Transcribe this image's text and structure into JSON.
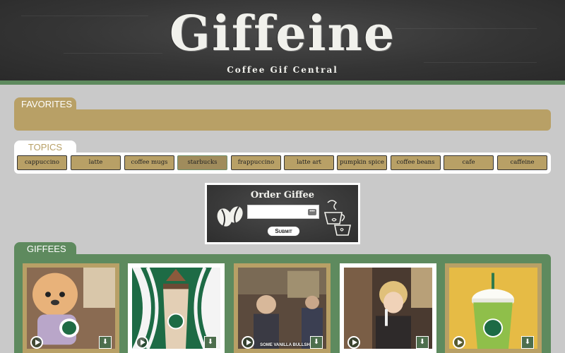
{
  "header": {
    "title": "Giffeine",
    "tagline": "Coffee Gif Central"
  },
  "favorites": {
    "tab_label": "FAVORITES"
  },
  "topics": {
    "tab_label": "TOPICS",
    "items": [
      "cappuccino",
      "latte",
      "coffee mugs",
      "starbucks",
      "frappuccino",
      "latte art",
      "pumpkin spice",
      "coffee beans",
      "cafe",
      "caffeine"
    ],
    "active": "starbucks"
  },
  "order": {
    "title": "Order Giffee",
    "input_value": "",
    "submit_label": "Submit"
  },
  "giffees": {
    "tab_label": "GIFFEES",
    "cards": [
      {
        "border": "#b8a066",
        "caption": ""
      },
      {
        "border": "#ffffff",
        "caption": ""
      },
      {
        "border": "#b8a066",
        "caption": "SOME VANILLA BULLSH*T,"
      },
      {
        "border": "#ffffff",
        "caption": ""
      },
      {
        "border": "#b8a066",
        "caption": ""
      }
    ]
  },
  "colors": {
    "gold": "#b8a066",
    "green": "#5e8a5e",
    "chalkboard": "#353535",
    "background": "#c9c9c9"
  }
}
